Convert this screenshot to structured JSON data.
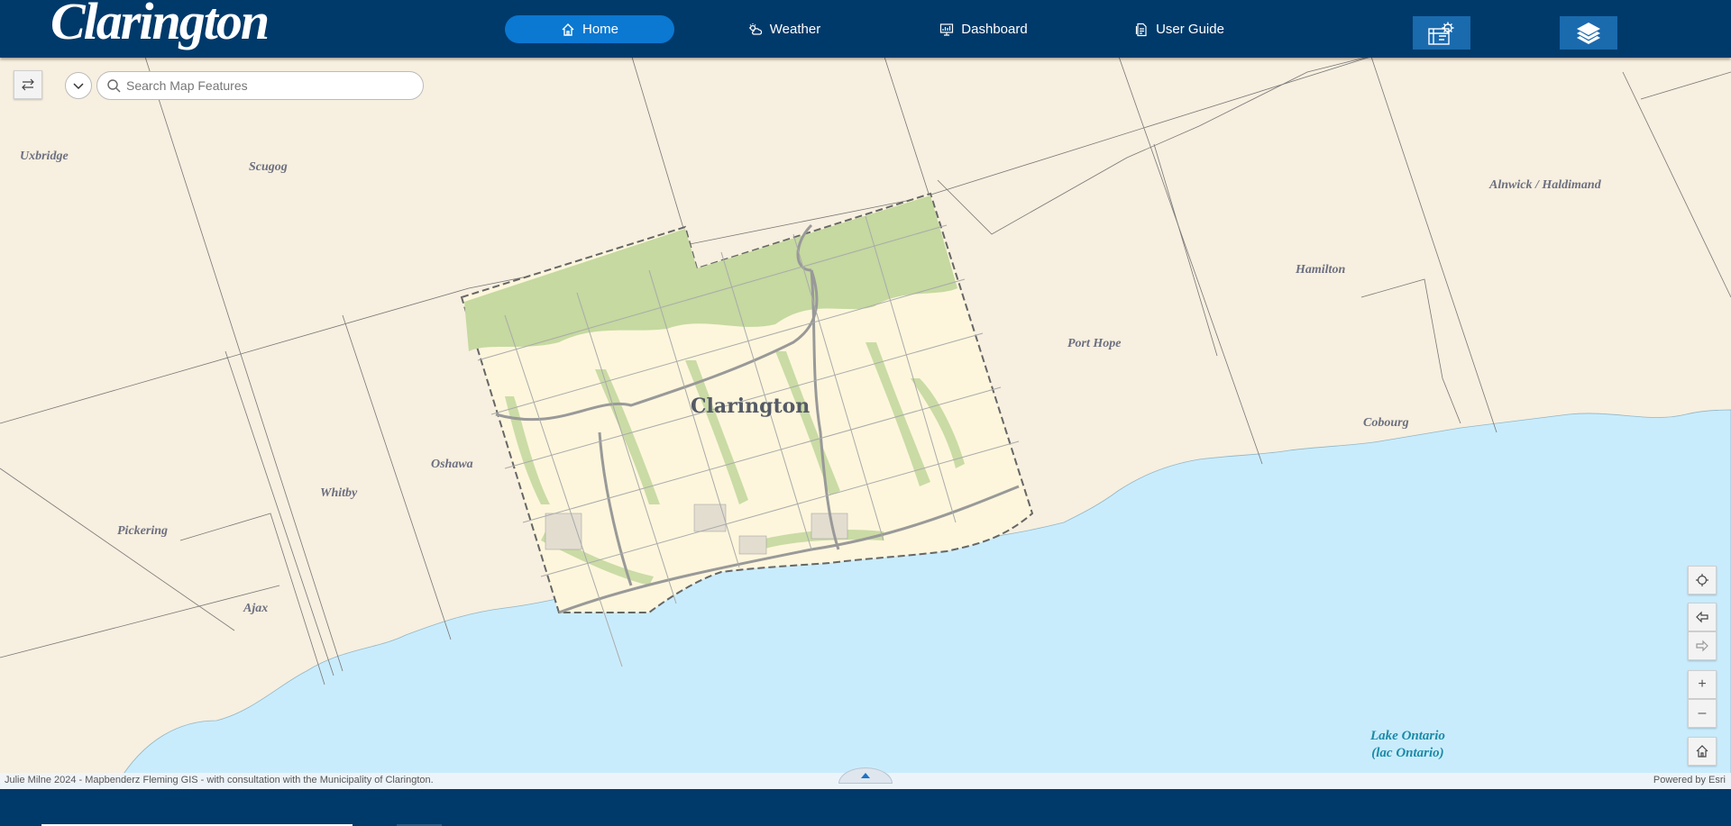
{
  "header": {
    "logo": "Clarington",
    "nav": [
      {
        "label": "Home",
        "icon": "home-icon",
        "active": true
      },
      {
        "label": "Weather",
        "icon": "weather-icon",
        "active": false
      },
      {
        "label": "Dashboard",
        "icon": "dashboard-icon",
        "active": false
      },
      {
        "label": "User Guide",
        "icon": "document-icon",
        "active": false
      }
    ],
    "tools_icon": "settings-gear-icon",
    "layers_icon": "layers-icon"
  },
  "search": {
    "placeholder": "Search Map Features"
  },
  "map": {
    "labels": {
      "uxbridge": "Uxbridge",
      "scugog": "Scugog",
      "alnwick": "Alnwick / Haldimand",
      "hamilton": "Hamilton",
      "port_hope": "Port Hope",
      "cobourg": "Cobourg",
      "oshawa": "Oshawa",
      "whitby": "Whitby",
      "pickering": "Pickering",
      "ajax": "Ajax",
      "clarington": "Clarington",
      "lake_line1": "Lake Ontario",
      "lake_line2": "(lac Ontario)"
    },
    "colors": {
      "land": "#f7efdf",
      "water": "#c9ecfc",
      "municipality": "#fdf6dc",
      "green": "#c5d9a0",
      "header": "#003a6b",
      "accent": "#0b78d1"
    }
  },
  "widgets": {
    "locate": "locate-icon",
    "back": "arrow-left-icon",
    "forward": "arrow-right-icon",
    "zoom_in": "+",
    "zoom_out": "–",
    "home": "home-icon"
  },
  "attribution": {
    "left": "Julie Milne 2024 - Mapbenderz Fleming GIS - with consultation with the Municipality of Clarington.",
    "right": "Powered by Esri"
  }
}
